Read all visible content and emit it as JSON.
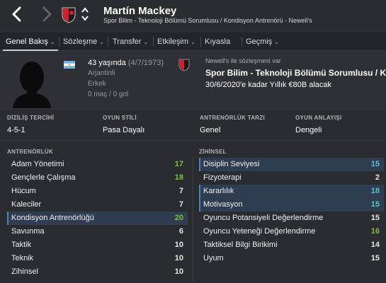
{
  "header": {
    "name": "Martín Mackey",
    "subtitle": "Spor Bilim - Teknoloji Bölümü Sorumlusu / Kondisyon Antrenörü - Newell's"
  },
  "tabs": [
    {
      "label": "Genel Bakış",
      "active": true,
      "dropdown": true
    },
    {
      "label": "Sözleşme",
      "active": false,
      "dropdown": true
    },
    {
      "label": "Transfer",
      "active": false,
      "dropdown": true
    },
    {
      "label": "Etkileşim",
      "active": false,
      "dropdown": true
    },
    {
      "label": "Kıyasla",
      "active": false,
      "dropdown": false
    },
    {
      "label": "Geçmiş",
      "active": false,
      "dropdown": true
    }
  ],
  "profile": {
    "age": "43 yaşında",
    "dob": "(4/7/1973)",
    "nationality": "Arjantinli",
    "gender": "Erkek",
    "apps": "0 maç / 0 gol",
    "contract_label": "Newell's ile sözleşmesi var",
    "contract_role": "Spor Bilim - Teknoloji Bölümü Sorumlusu / Kondisyon Antrenörü",
    "contract_term": "30/6/2020'e kadar Yıllık €80B alacak"
  },
  "styles": [
    {
      "heading": "DİZİLİŞ TERCİHİ",
      "value": "4-5-1"
    },
    {
      "heading": "OYUN STİLİ",
      "value": "Pasa Dayalı"
    },
    {
      "heading": "ANTRENÖRLÜK TARZI",
      "value": "Genel"
    },
    {
      "heading": "OYUN ANLAYIŞI",
      "value": "Dengeli"
    }
  ],
  "coaching": {
    "heading": "ANTRENÖRLÜK",
    "rows": [
      {
        "name": "Adam Yönetimi",
        "value": "17",
        "color": "#7cc142",
        "highlight": false
      },
      {
        "name": "Gençlerle Çalışma",
        "value": "18",
        "color": "#7cc142",
        "highlight": false
      },
      {
        "name": "Hücum",
        "value": "7",
        "color": "#e6e6e6",
        "highlight": false
      },
      {
        "name": "Kaleciler",
        "value": "7",
        "color": "#e6e6e6",
        "highlight": false
      },
      {
        "name": "Kondisyon Antrenörlüğü",
        "value": "20",
        "color": "#7cc142",
        "highlight": true
      },
      {
        "name": "Savunma",
        "value": "6",
        "color": "#e6e6e6",
        "highlight": false
      },
      {
        "name": "Taktik",
        "value": "10",
        "color": "#e6e6e6",
        "highlight": false
      },
      {
        "name": "Teknik",
        "value": "10",
        "color": "#e6e6e6",
        "highlight": false
      },
      {
        "name": "Zihinsel",
        "value": "10",
        "color": "#e6e6e6",
        "highlight": false
      }
    ]
  },
  "mental": {
    "heading": "ZİHİNSEL",
    "rows": [
      {
        "name": "Disiplin Seviyesi",
        "value": "15",
        "color": "#5ec3cf",
        "highlight": true
      },
      {
        "name": "Fizyoterapi",
        "value": "2",
        "color": "#e6e6e6",
        "highlight": false
      },
      {
        "name": "Kararlılık",
        "value": "18",
        "color": "#5ec3cf",
        "highlight": true
      },
      {
        "name": "Motivasyon",
        "value": "15",
        "color": "#5ec3cf",
        "highlight": true
      },
      {
        "name": "Oyuncu Potansiyeli Değerlendirme",
        "value": "15",
        "color": "#e6e6e6",
        "highlight": false
      },
      {
        "name": "Oyuncu Yeteneği Değerlendirme",
        "value": "16",
        "color": "#7cc142",
        "highlight": false
      },
      {
        "name": "Taktiksel Bilgi Birikimi",
        "value": "14",
        "color": "#e6e6e6",
        "highlight": false
      },
      {
        "name": "Uyum",
        "value": "15",
        "color": "#e6e6e6",
        "highlight": false
      }
    ]
  },
  "icons": {
    "back": "chevron-left-icon",
    "forward": "chevron-right-icon",
    "club": "club-crest-icon",
    "switch": "up-down-icon",
    "flag": "argentina-flag-icon",
    "avatar": "person-silhouette-icon"
  }
}
